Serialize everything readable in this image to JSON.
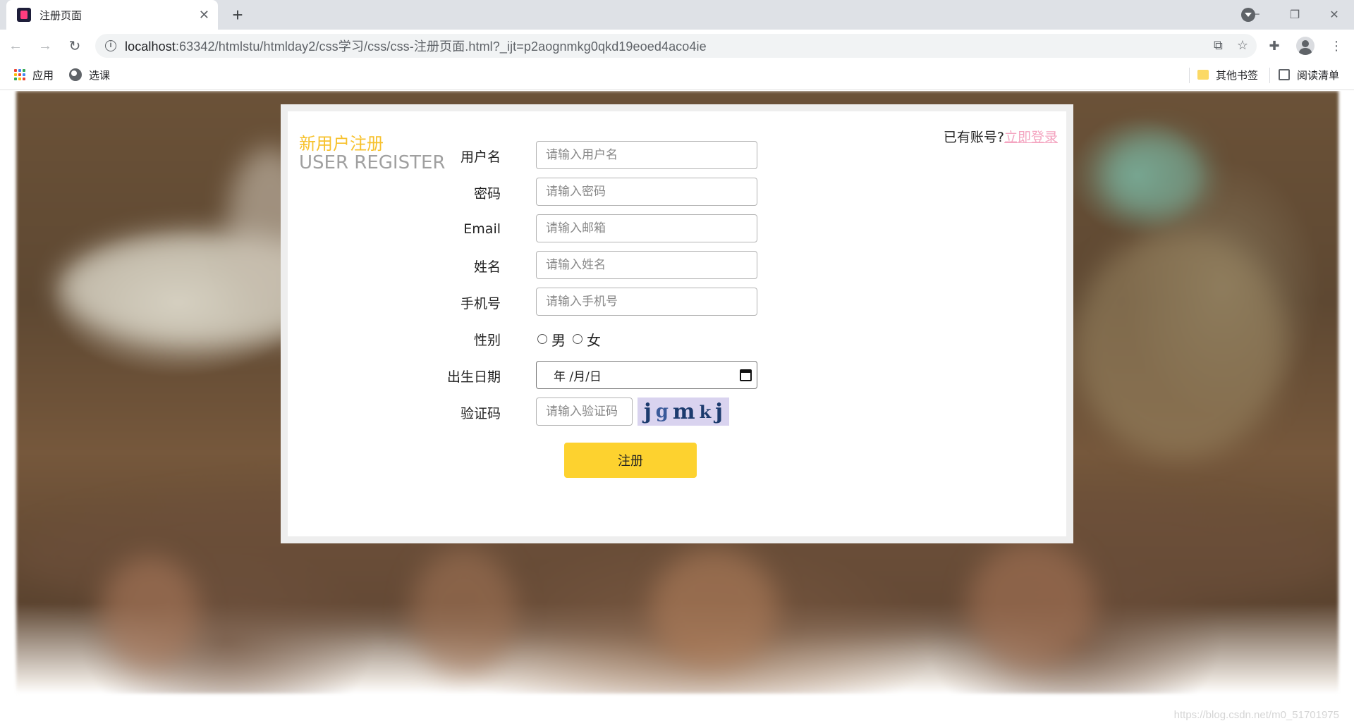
{
  "browser": {
    "tab_title": "注册页面",
    "url_host": "localhost",
    "url_rest": ":63342/htmlstu/htmlday2/css学习/css/css-注册页面.html?_ijt=p2aognmkg0qkd19eoed4aco4ie",
    "bookmarks": {
      "apps_label": "应用",
      "xuanke_label": "选课",
      "other_label": "其他书签",
      "reading_label": "阅读清单"
    }
  },
  "page": {
    "title_cn": "新用户注册",
    "title_en": "USER REGISTER",
    "login_prompt": "已有账号?",
    "login_link": "立即登录",
    "fields": {
      "username": {
        "label": "用户名",
        "placeholder": "请输入用户名"
      },
      "password": {
        "label": "密码",
        "placeholder": "请输入密码"
      },
      "email": {
        "label": "Email",
        "placeholder": "请输入邮箱"
      },
      "name": {
        "label": "姓名",
        "placeholder": "请输入姓名"
      },
      "phone": {
        "label": "手机号",
        "placeholder": "请输入手机号"
      },
      "gender": {
        "label": "性别",
        "male": "男",
        "female": "女"
      },
      "birthday": {
        "label": "出生日期",
        "value": "年 /月/日"
      },
      "captcha": {
        "label": "验证码",
        "placeholder": "请输入验证码",
        "chars": [
          "j",
          "g",
          "m",
          "k",
          "j"
        ]
      }
    },
    "submit_label": "注册",
    "watermark": "https://blog.csdn.net/m0_51701975"
  },
  "colors": {
    "accent_yellow": "#f7c12c",
    "button_yellow": "#fdd22f",
    "link_pink": "#f4a4c0",
    "subtitle_gray": "#a0a0a0"
  }
}
